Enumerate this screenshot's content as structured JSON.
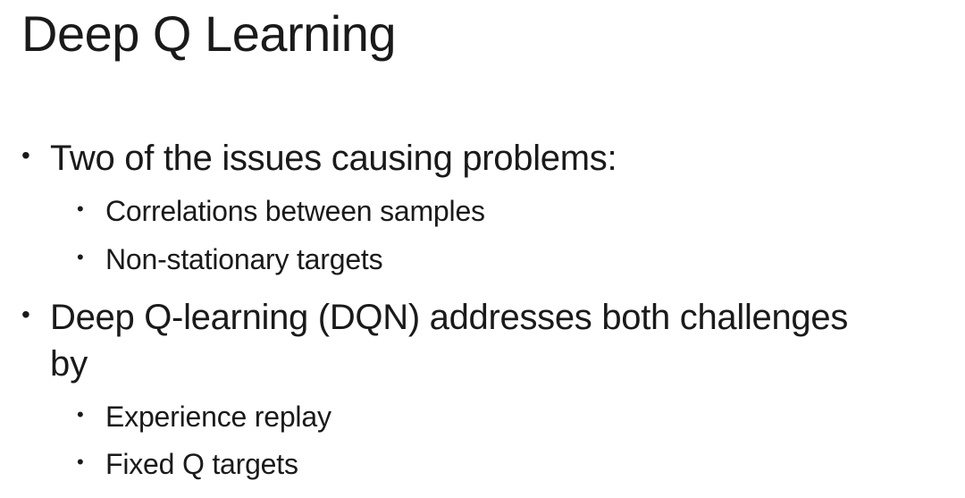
{
  "slide": {
    "title": "Deep Q Learning",
    "bullet_glyph": "•",
    "items": [
      {
        "text": "Two of the issues causing problems:"
      },
      {
        "text": "Correlations between samples"
      },
      {
        "text": "Non-stationary targets"
      },
      {
        "text": "Deep Q-learning (DQN) addresses both challenges",
        "continuation": "by"
      },
      {
        "text": "Experience replay"
      },
      {
        "text": "Fixed Q targets"
      }
    ]
  }
}
